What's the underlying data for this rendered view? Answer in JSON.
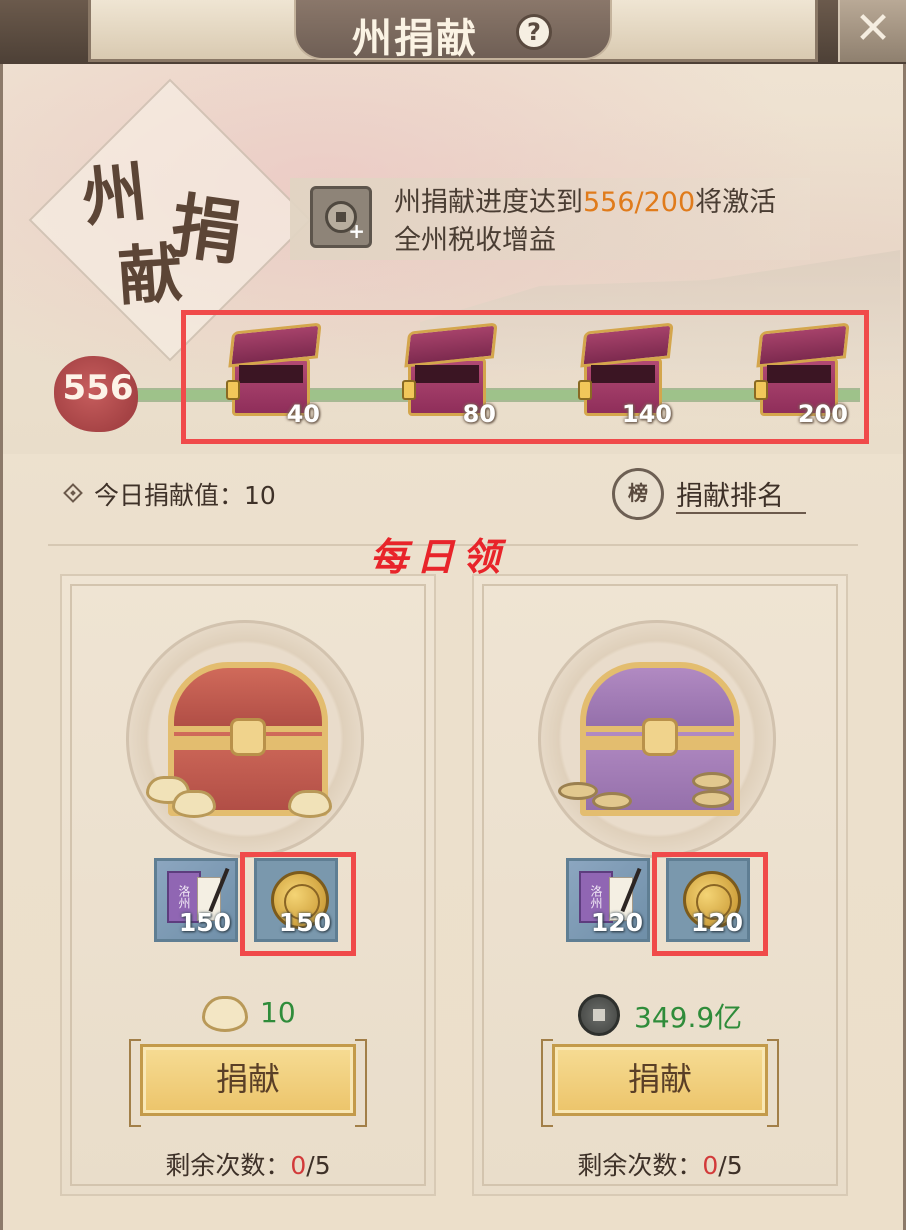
{
  "header": {
    "title": "州捐献",
    "help_icon": "?",
    "close_icon": "✕"
  },
  "banner": {
    "calligraphy": [
      "州",
      "捐",
      "献"
    ],
    "info_prefix": "州捐献进度达到",
    "info_progress": "556/200",
    "info_suffix": "将激活",
    "info_line2": "全州税收增益"
  },
  "progress": {
    "current": "556",
    "fill_fraction": 1.0,
    "milestones": [
      {
        "value": "40"
      },
      {
        "value": "80"
      },
      {
        "value": "140"
      },
      {
        "value": "200"
      }
    ]
  },
  "today": {
    "label": "今日捐献值：10"
  },
  "ranking": {
    "icon_char": "榜",
    "label": "捐献排名"
  },
  "annotation": {
    "daily_note": "每日领"
  },
  "tiers": [
    {
      "rewards": [
        {
          "icon": "book-icon",
          "book_text": "洛州",
          "qty": "150"
        },
        {
          "icon": "gold-coin-icon",
          "qty": "150"
        }
      ],
      "cost_icon": "gold-ingot-icon",
      "cost": "10",
      "button": "捐献",
      "remaining_label": "剩余次数：",
      "remaining_used": "0",
      "remaining_total": "/5"
    },
    {
      "rewards": [
        {
          "icon": "book-icon",
          "book_text": "洛州",
          "qty": "120"
        },
        {
          "icon": "gold-coin-icon",
          "qty": "120"
        }
      ],
      "cost_icon": "copper-coin-icon",
      "cost": "349.9亿",
      "button": "捐献",
      "remaining_label": "剩余次数：",
      "remaining_used": "0",
      "remaining_total": "/5"
    }
  ],
  "colors": {
    "highlight_box": "#f04a4a",
    "progress_text": "#e07b1b",
    "cost_text": "#2f8c3a",
    "remaining_used": "#d23a3a"
  }
}
